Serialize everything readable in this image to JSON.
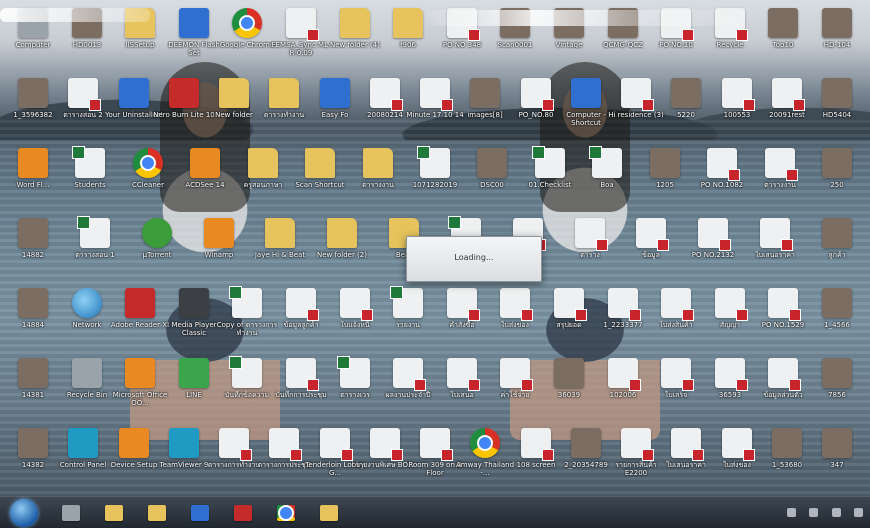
{
  "desktop": {
    "icons": [
      {
        "label": "Computer",
        "type": "pc"
      },
      {
        "label": "HD0013",
        "type": "img"
      },
      {
        "label": "IISSetup",
        "type": "folder"
      },
      {
        "label": "DEEMON Flash Set",
        "type": "blue"
      },
      {
        "label": "Google Chrome",
        "type": "chrome"
      },
      {
        "label": "FEMSA_Sync ML-R-0.09",
        "type": "doc"
      },
      {
        "label": "New folder (4)",
        "type": "folder"
      },
      {
        "label": "f906",
        "type": "folder"
      },
      {
        "label": "PO NO 348",
        "type": "doc"
      },
      {
        "label": "Scan0001",
        "type": "img"
      },
      {
        "label": "Vintage",
        "type": "img"
      },
      {
        "label": "QCMG-QCZ",
        "type": "img"
      },
      {
        "label": "PO NO.10",
        "type": "doc"
      },
      {
        "label": "Recycle",
        "type": "doc"
      },
      {
        "label": "Top10",
        "type": "img"
      },
      {
        "label": "HD-104",
        "type": "img"
      },
      {
        "label": "1_3596382",
        "type": "img"
      },
      {
        "label": "ตารางสอน 2",
        "type": "doc"
      },
      {
        "label": "Your Uninstaller!",
        "type": "blue"
      },
      {
        "label": "Nero Burn Lite 10",
        "type": "red"
      },
      {
        "label": "New folder",
        "type": "folder"
      },
      {
        "label": "ตารางทำงาน",
        "type": "folder"
      },
      {
        "label": "Easy Fo",
        "type": "blue"
      },
      {
        "label": "20080214",
        "type": "doc"
      },
      {
        "label": "Minute 17 10 14",
        "type": "doc"
      },
      {
        "label": "images[8]",
        "type": "img"
      },
      {
        "label": "PO_NO.80",
        "type": "doc"
      },
      {
        "label": "Computer - Shortcut",
        "type": "blue"
      },
      {
        "label": "Hi residence (3)",
        "type": "doc"
      },
      {
        "label": "5220",
        "type": "img"
      },
      {
        "label": "100553",
        "type": "doc"
      },
      {
        "label": "20091rest",
        "type": "doc"
      },
      {
        "label": "HD5404",
        "type": "img"
      },
      {
        "label": "Word Fl...",
        "type": "orange"
      },
      {
        "label": "Students",
        "type": "xls"
      },
      {
        "label": "CCleaner",
        "type": "chrome"
      },
      {
        "label": "ACDSee 14",
        "type": "orange"
      },
      {
        "label": "ครูสอนภาษา",
        "type": "folder"
      },
      {
        "label": "Scan Shortcut",
        "type": "folder"
      },
      {
        "label": "ตารางงาน",
        "type": "folder"
      },
      {
        "label": "1071282019",
        "type": "xls"
      },
      {
        "label": "DSC00",
        "type": "img"
      },
      {
        "label": "01.Checklist",
        "type": "xls"
      },
      {
        "label": "Boa",
        "type": "xls"
      },
      {
        "label": "1205",
        "type": "img"
      },
      {
        "label": "PO NO.1082",
        "type": "doc"
      },
      {
        "label": "ตารางงาน",
        "type": "doc"
      },
      {
        "label": "250",
        "type": "img"
      },
      {
        "label": "14882",
        "type": "img"
      },
      {
        "label": "ตารางสอน 1",
        "type": "xls"
      },
      {
        "label": "µTorrent",
        "type": "torrent"
      },
      {
        "label": "Winamp",
        "type": "orange"
      },
      {
        "label": "Jaye Hi & Beat",
        "type": "folder"
      },
      {
        "label": "New folder (2)",
        "type": "folder"
      },
      {
        "label": "Beat",
        "type": "folder"
      },
      {
        "label": "ตารางทำงาน",
        "type": "xls"
      },
      {
        "label": "ใบสั่งซื้อ",
        "type": "doc"
      },
      {
        "label": "ตาราง",
        "type": "doc"
      },
      {
        "label": "ข้อมูล",
        "type": "doc"
      },
      {
        "label": "PO NO.2132",
        "type": "doc"
      },
      {
        "label": "ใบเสนอราคา",
        "type": "doc"
      },
      {
        "label": "ลูกค้า",
        "type": "img"
      },
      {
        "label": "14884",
        "type": "img"
      },
      {
        "label": "Network",
        "type": "globe"
      },
      {
        "label": "Adobe Reader XI",
        "type": "red"
      },
      {
        "label": "Media Player Classic",
        "type": "dark"
      },
      {
        "label": "Copy of ตารางการทำงาน",
        "type": "xls"
      },
      {
        "label": "ข้อมูลลูกค้า",
        "type": "doc"
      },
      {
        "label": "ใบแจ้งหนี้",
        "type": "doc"
      },
      {
        "label": "รายงาน",
        "type": "xls"
      },
      {
        "label": "คำสั่งซื้อ",
        "type": "doc"
      },
      {
        "label": "ใบส่งของ",
        "type": "doc"
      },
      {
        "label": "สรุปยอด",
        "type": "doc"
      },
      {
        "label": "1_2233377",
        "type": "doc"
      },
      {
        "label": "ใบส่งสินค้า",
        "type": "doc"
      },
      {
        "label": "สัญญา",
        "type": "doc"
      },
      {
        "label": "PO NO.1529",
        "type": "doc"
      },
      {
        "label": "1_4566",
        "type": "img"
      },
      {
        "label": "14381",
        "type": "img"
      },
      {
        "label": "Recycle Bin",
        "type": "gray"
      },
      {
        "label": "Microsoft Office OO...",
        "type": "orange"
      },
      {
        "label": "LINE",
        "type": "green"
      },
      {
        "label": "บันทึกข้อความ",
        "type": "xls"
      },
      {
        "label": "บันทึกการประชุม",
        "type": "doc"
      },
      {
        "label": "ตารางเวร",
        "type": "xls"
      },
      {
        "label": "ผลงานประจำปี",
        "type": "doc"
      },
      {
        "label": "ใบเสนอ",
        "type": "doc"
      },
      {
        "label": "ค่าใช้จ่าย",
        "type": "doc"
      },
      {
        "label": "36039",
        "type": "img"
      },
      {
        "label": "102006",
        "type": "doc"
      },
      {
        "label": "ใบเสร็จ",
        "type": "doc"
      },
      {
        "label": "36593",
        "type": "doc"
      },
      {
        "label": "ข้อมูลส่วนตัว",
        "type": "doc"
      },
      {
        "label": "7856",
        "type": "img"
      },
      {
        "label": "14382",
        "type": "img"
      },
      {
        "label": "Control Panel",
        "type": "teal"
      },
      {
        "label": "Device Setup",
        "type": "orange"
      },
      {
        "label": "TeamViewer 9",
        "type": "teal"
      },
      {
        "label": "ตารางการทำงาน",
        "type": "doc"
      },
      {
        "label": "ตารางการประชุม",
        "type": "doc"
      },
      {
        "label": "Tenderloin Lobby G...",
        "type": "doc"
      },
      {
        "label": "รายงานพิเศษ BO...",
        "type": "doc"
      },
      {
        "label": "Room 309 on 9 Floor",
        "type": "doc"
      },
      {
        "label": "Amway Thailand -...",
        "type": "chrome"
      },
      {
        "label": "108 screen",
        "type": "doc"
      },
      {
        "label": "2_20354789",
        "type": "img"
      },
      {
        "label": "รายการสินค้า E2200",
        "type": "doc"
      },
      {
        "label": "ใบเสนอราคา",
        "type": "doc"
      },
      {
        "label": "ใบส่งของ",
        "type": "doc"
      },
      {
        "label": "1_53680",
        "type": "img"
      },
      {
        "label": "347",
        "type": "img"
      }
    ]
  },
  "dialog": {
    "text": "Loading..."
  },
  "taskbar": {
    "items": [
      {
        "name": "media-player",
        "type": "gray"
      },
      {
        "name": "explorer",
        "type": "folder"
      },
      {
        "name": "folder",
        "type": "folder"
      },
      {
        "name": "ie",
        "type": "blue"
      },
      {
        "name": "adobe",
        "type": "red"
      },
      {
        "name": "chrome",
        "type": "chrome"
      },
      {
        "name": "folder-2",
        "type": "folder"
      }
    ]
  }
}
